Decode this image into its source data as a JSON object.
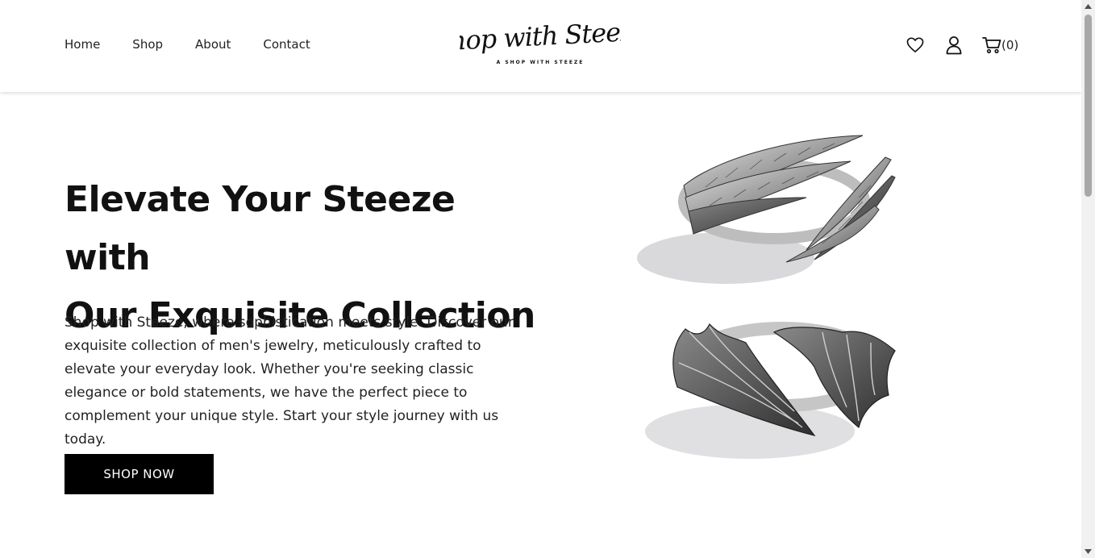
{
  "nav": {
    "items": [
      {
        "label": "Home"
      },
      {
        "label": "Shop"
      },
      {
        "label": "About"
      },
      {
        "label": "Contact"
      }
    ]
  },
  "logo": {
    "script_text": "Shop with Steeze",
    "tagline": "A SHOP WITH STEEZE"
  },
  "header_icons": {
    "wishlist": "heart-icon",
    "account": "user-icon",
    "cart": "cart-icon",
    "cart_count": "(0)"
  },
  "hero": {
    "title_line1": "Elevate Your Steeze with",
    "title_line2": "Our Exquisite Collection",
    "description": "Shop with Steeze, where sophistication meets style. Discover our exquisite collection of men's jewelry, meticulously crafted to elevate your everyday look. Whether you're seeking classic elegance or bold statements, we have the perfect piece to complement your unique style. Start your style journey with us today.",
    "cta_label": "SHOP NOW"
  },
  "colors": {
    "button_bg": "#000000",
    "button_text": "#ffffff",
    "text": "#111111"
  }
}
